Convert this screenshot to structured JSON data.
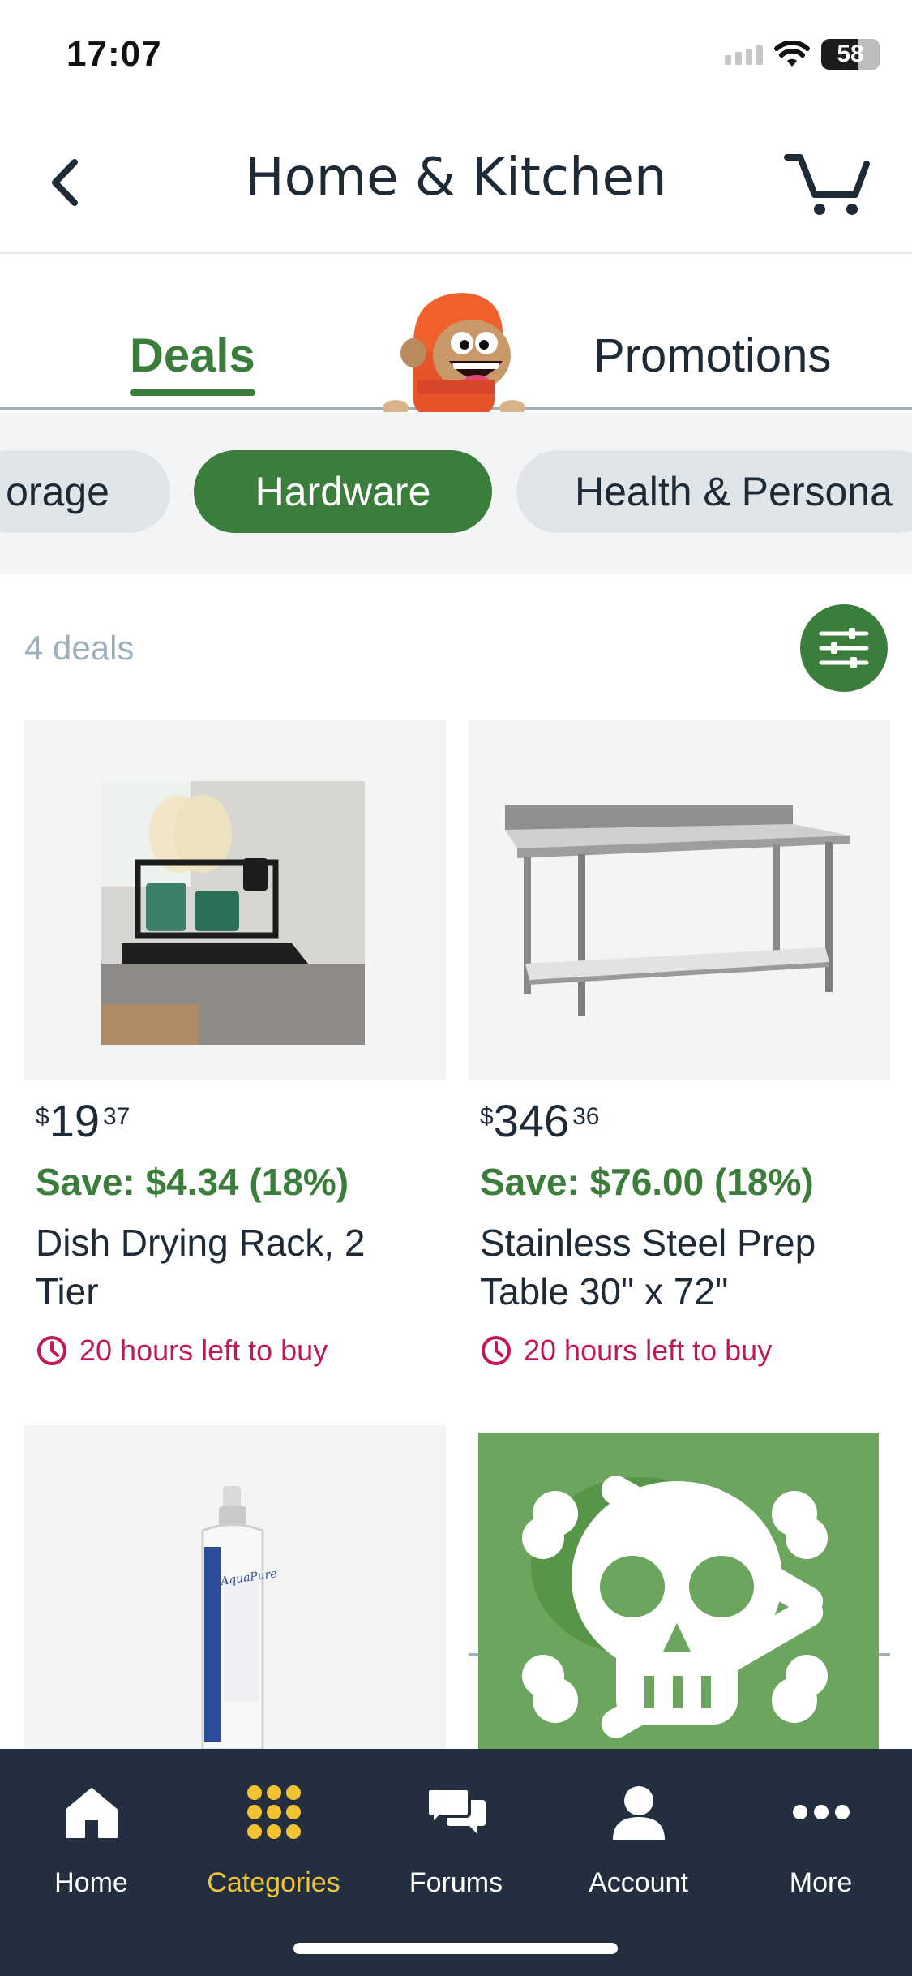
{
  "status_bar": {
    "time": "17:07",
    "battery": "58"
  },
  "header": {
    "title": "Home & Kitchen"
  },
  "tabs": {
    "deals": "Deals",
    "promotions": "Promotions"
  },
  "categories": [
    {
      "label": "orage",
      "selected": false
    },
    {
      "label": "Hardware",
      "selected": true
    },
    {
      "label": "Health & Persona",
      "selected": false
    }
  ],
  "deals_count": "4 deals",
  "products": [
    {
      "currency": "$",
      "price_whole": "19",
      "price_fraction": "37",
      "save": "Save: $4.34 (18%)",
      "name_line1": "Dish Drying Rack, 2",
      "name_line2": "Tier",
      "time_left": "20 hours left to buy"
    },
    {
      "currency": "$",
      "price_whole": "346",
      "price_fraction": "36",
      "save": "Save: $76.00 (18%)",
      "name_line1": "Stainless Steel Prep",
      "name_line2": "Table 30\" x 72\"",
      "time_left": "20 hours left to buy"
    },
    {
      "image_label": "AquaPure"
    },
    {
      "image_label": ""
    }
  ],
  "bottom_nav": [
    {
      "label": "Home",
      "icon": "home-icon",
      "active": false
    },
    {
      "label": "Categories",
      "icon": "grid-icon",
      "active": true
    },
    {
      "label": "Forums",
      "icon": "chat-bubbles-icon",
      "active": false
    },
    {
      "label": "Account",
      "icon": "person-icon",
      "active": false
    },
    {
      "label": "More",
      "icon": "more-dots-icon",
      "active": false
    }
  ],
  "colors": {
    "brand_green": "#3b7d3a",
    "nav_bg": "#232f3e",
    "active_nav": "#f2c230",
    "urgency": "#c2185b"
  }
}
